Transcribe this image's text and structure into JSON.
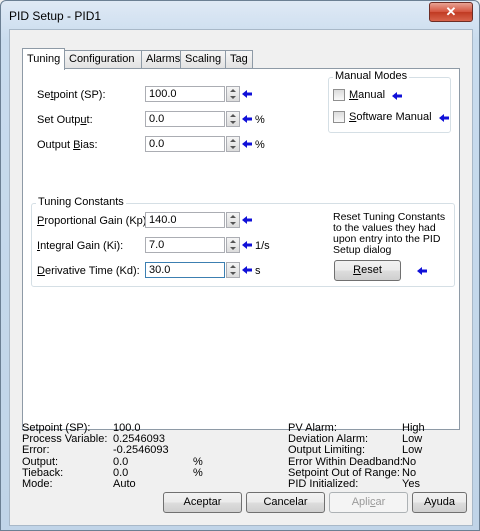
{
  "window": {
    "title": "PID Setup - PID1",
    "close_glyph": "✕"
  },
  "tabs": [
    {
      "label": "Tuning"
    },
    {
      "label": "Configuration"
    },
    {
      "label": "Alarms"
    },
    {
      "label": "Scaling"
    },
    {
      "label": "Tag"
    }
  ],
  "tuning": {
    "setpoint": {
      "label_pre": "Se",
      "label_u": "t",
      "label_post": "point (SP):",
      "value": "100.0",
      "unit": ""
    },
    "set_output": {
      "label_pre": "Set Outp",
      "label_u": "u",
      "label_post": "t:",
      "value": "0.0",
      "unit": "%"
    },
    "output_bias": {
      "label_pre": "Output ",
      "label_u": "B",
      "label_post": "ias:",
      "value": "0.0",
      "unit": "%"
    }
  },
  "manual_modes": {
    "title": "Manual Modes",
    "manual": {
      "label_pre": "",
      "label_u": "M",
      "label_post": "anual",
      "checked": false
    },
    "software_manual": {
      "label_pre": "",
      "label_u": "S",
      "label_post": "oftware Manual",
      "checked": false
    }
  },
  "tuning_constants": {
    "title": "Tuning Constants",
    "kp": {
      "label_pre": "",
      "label_u": "P",
      "label_post": "roportional Gain (Kp):",
      "value": "140.0",
      "unit": ""
    },
    "ki": {
      "label_pre": "",
      "label_u": "I",
      "label_post": "ntegral Gain (Ki):",
      "value": "7.0",
      "unit": "1/s"
    },
    "kd": {
      "label_pre": "",
      "label_u": "D",
      "label_post": "erivative Time (Kd):",
      "value": "30.0",
      "unit": "s"
    },
    "reset_note": "Reset Tuning Constants to the values they had upon entry into the PID Setup dialog",
    "reset_button": {
      "label_pre": "",
      "label_u": "R",
      "label_post": "eset"
    }
  },
  "status": {
    "left": [
      {
        "label": "Setpoint (SP):",
        "value": "100.0",
        "unit": ""
      },
      {
        "label": "Process Variable:",
        "value": "0.2546093",
        "unit": ""
      },
      {
        "label": "Error:",
        "value": "-0.2546093",
        "unit": ""
      },
      {
        "label": "Output:",
        "value": "0.0",
        "unit": "%"
      },
      {
        "label": "Tieback:",
        "value": "0.0",
        "unit": "%"
      },
      {
        "label": "Mode:",
        "value": "Auto",
        "unit": ""
      }
    ],
    "right": [
      {
        "label": "PV Alarm:",
        "value": "High"
      },
      {
        "label": "Deviation Alarm:",
        "value": "Low"
      },
      {
        "label": "Output Limiting:",
        "value": "Low"
      },
      {
        "label": "Error Within Deadband:",
        "value": "No"
      },
      {
        "label": "Setpoint Out of Range:",
        "value": "No"
      },
      {
        "label": "PID Initialized:",
        "value": "Yes"
      }
    ]
  },
  "buttons": {
    "accept": "Aceptar",
    "cancel": "Cancelar",
    "apply": {
      "label_pre": "Apli",
      "label_u": "c",
      "label_post": "ar"
    },
    "help": "Ayuda"
  },
  "colors": {
    "arrow": "#1010d8",
    "accent_border": "#3c7fb1"
  }
}
